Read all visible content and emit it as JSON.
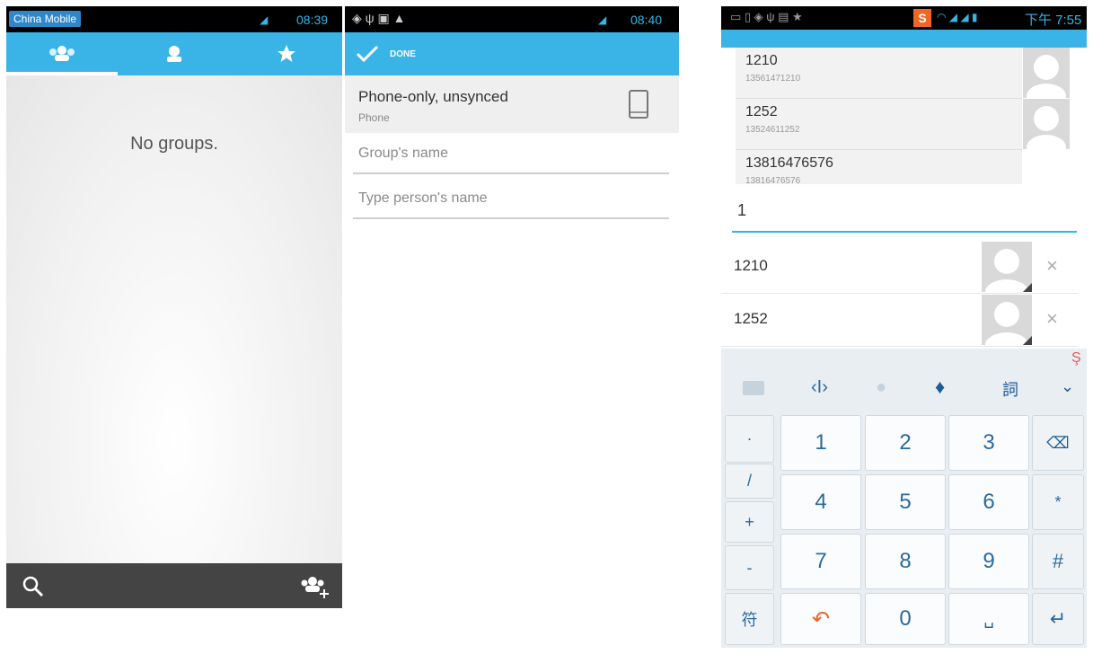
{
  "screen1": {
    "status_carrier": "China Mobile",
    "status_time": "08:39",
    "tabs": [
      {
        "name": "groups-tab-icon"
      },
      {
        "name": "contacts-tab-icon"
      },
      {
        "name": "favorites-tab-icon"
      }
    ],
    "empty_message": "No groups.",
    "bottom": {
      "search_icon": "search-icon",
      "add_group_icon": "add-group-icon"
    }
  },
  "screen2": {
    "status_time": "08:40",
    "done_label": "DONE",
    "account_title": "Phone-only, unsynced",
    "account_sub": "Phone",
    "group_name_placeholder": "Group's name",
    "person_name_placeholder": "Type person's name"
  },
  "screen3": {
    "status_time": "下午 7:55",
    "suggestions": [
      {
        "name": "1210",
        "phone": "13561471210"
      },
      {
        "name": "1252",
        "phone": "13524611252"
      },
      {
        "name": "13816476576",
        "phone": "13816476576"
      }
    ],
    "input_value": "1",
    "members": [
      {
        "name": "1210"
      },
      {
        "name": "1252"
      }
    ],
    "keyboard": {
      "toolbar": [
        "keyboard-icon",
        "cursor-icon",
        "mic-icon",
        "skin-icon",
        "dictionary-icon",
        "collapse-icon"
      ],
      "left_keys": [
        "·",
        "/",
        "+",
        "-"
      ],
      "digits": [
        [
          "1",
          "2",
          "3"
        ],
        [
          "4",
          "5",
          "6"
        ],
        [
          "7",
          "8",
          "9"
        ]
      ],
      "right_keys": [
        "⌫",
        "*",
        "#"
      ],
      "bottom_left": "符",
      "bottom_zero": "0",
      "bottom_space": "␣",
      "bottom_enter": "↵"
    }
  }
}
